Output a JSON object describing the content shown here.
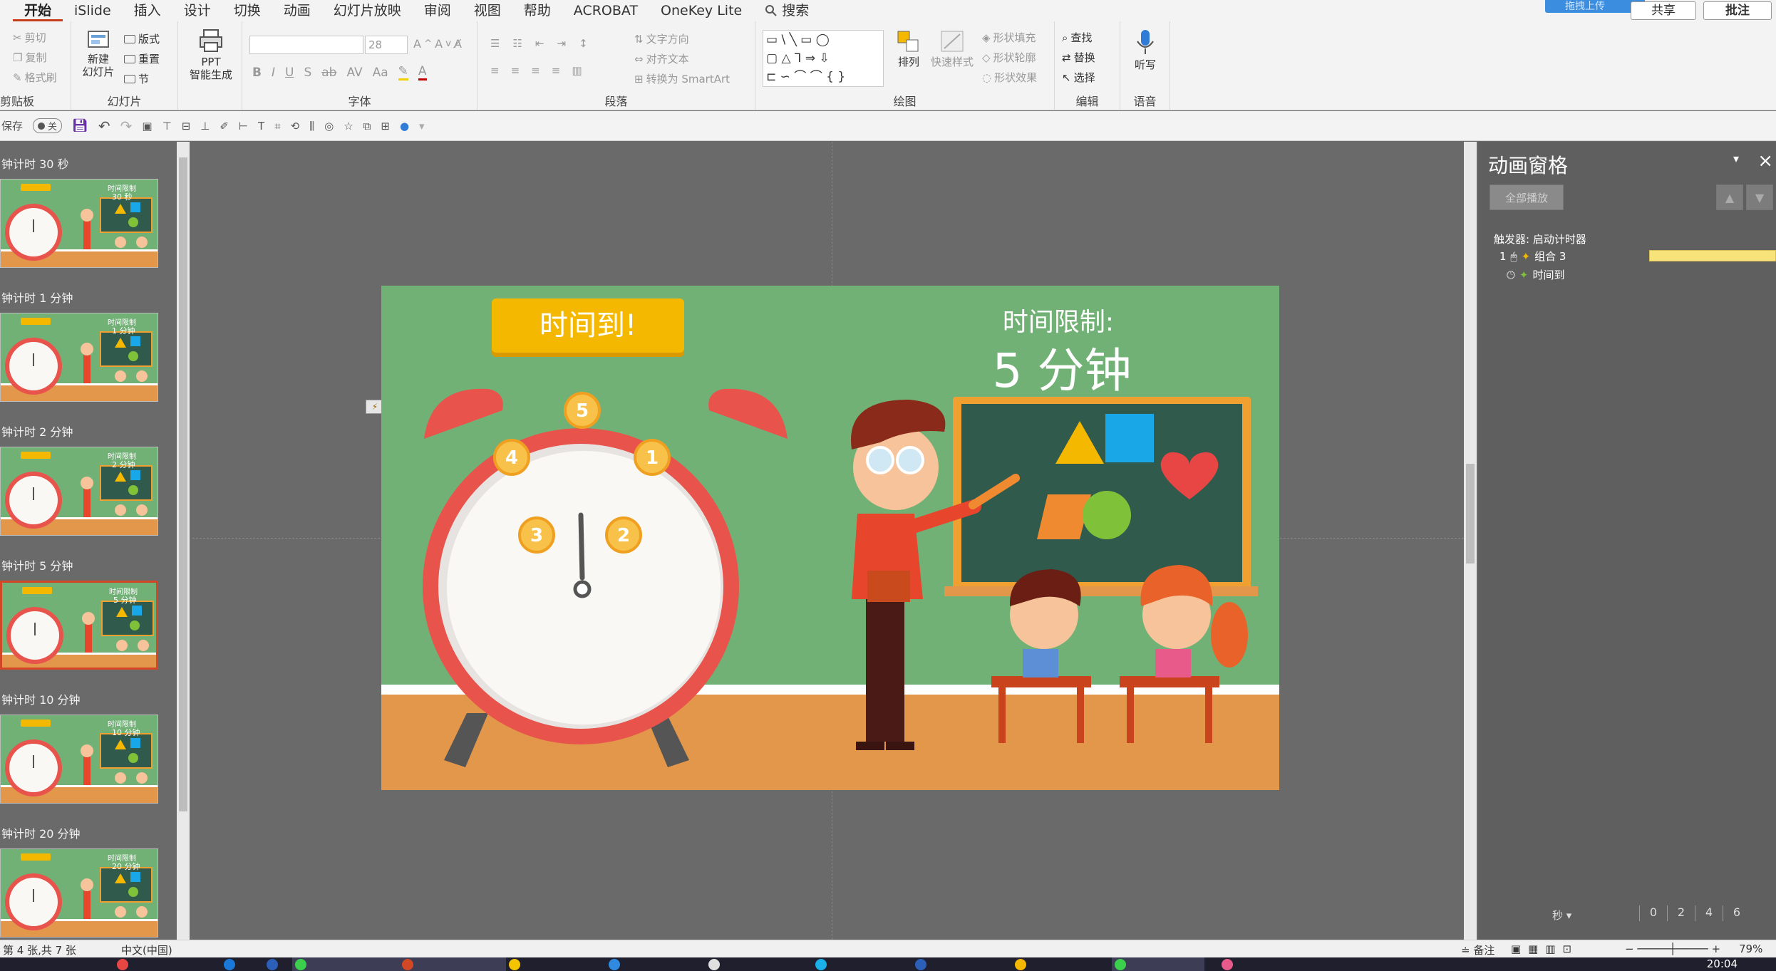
{
  "ribbon": {
    "tabs": [
      "开始",
      "iSlide",
      "插入",
      "设计",
      "切换",
      "动画",
      "幻灯片放映",
      "审阅",
      "视图",
      "帮助",
      "ACROBAT",
      "OneKey Lite"
    ],
    "search_label": "搜索",
    "share_label": "共享",
    "comment_label": "批注",
    "cloud_badge": "拖拽上传",
    "clipboard": {
      "cut": "剪切",
      "copy": "复制",
      "painter": "格式刷",
      "label": "剪贴板"
    },
    "slides": {
      "new_slide_line1": "新建",
      "new_slide_line2": "幻灯片",
      "layout": "版式",
      "reset": "重置",
      "section": "节",
      "label": "幻灯片"
    },
    "ppt_gen": {
      "line1": "PPT",
      "line2": "智能生成"
    },
    "font": {
      "font_name": "",
      "font_size": "28",
      "label": "字体"
    },
    "paragraph": {
      "text_direction": "文字方向",
      "align_text": "对齐文本",
      "smartart": "转换为 SmartArt",
      "label": "段落"
    },
    "drawing": {
      "arrange": "排列",
      "quick_styles": "快速样式",
      "shape_fill": "形状填充",
      "shape_outline": "形状轮廓",
      "shape_effects": "形状效果",
      "label": "绘图"
    },
    "editing": {
      "find": "查找",
      "replace": "替换",
      "select": "选择",
      "label": "编辑"
    },
    "voice": {
      "dictate": "听写",
      "label": "语音"
    }
  },
  "qat": {
    "autosave_label": "保存",
    "autosave_state": "关"
  },
  "thumbnails": [
    {
      "title": "钟计时 30 秒",
      "label": "30 秒",
      "selected": false
    },
    {
      "title": "钟计时 1 分钟",
      "label": "1 分钟",
      "selected": false
    },
    {
      "title": "钟计时 2 分钟",
      "label": "2 分钟",
      "selected": false
    },
    {
      "title": "钟计时 5 分钟",
      "label": "5 分钟",
      "selected": true
    },
    {
      "title": "钟计时 10 分钟",
      "label": "10 分钟",
      "selected": false
    },
    {
      "title": "钟计时 20 分钟",
      "label": "20 分钟",
      "selected": false
    }
  ],
  "slide": {
    "time_up": "时间到!",
    "limit_label": "时间限制:",
    "limit_value": "5 分钟",
    "clock_numbers": [
      "5",
      "1",
      "2",
      "3",
      "4"
    ],
    "thumb_header": "时间限制"
  },
  "anim_pane": {
    "title": "动画窗格",
    "play_all": "全部播放",
    "trigger": "触发器: 启动计时器",
    "items": [
      {
        "index": "1",
        "name": "组合 3"
      },
      {
        "index": "",
        "name": "时间到"
      }
    ],
    "seconds_label": "秒",
    "ruler": [
      "0",
      "2",
      "4",
      "6"
    ]
  },
  "status": {
    "slide_info": "第 4 张,共 7 张",
    "language": "中文(中国)",
    "notes": "备注",
    "zoom": "79%"
  },
  "taskbar": {
    "time": "20:04"
  },
  "colors": {
    "accent": "#c43e1c",
    "slide_bg": "#72b176",
    "banner": "#f5b800",
    "clock_red": "#e8534c"
  }
}
